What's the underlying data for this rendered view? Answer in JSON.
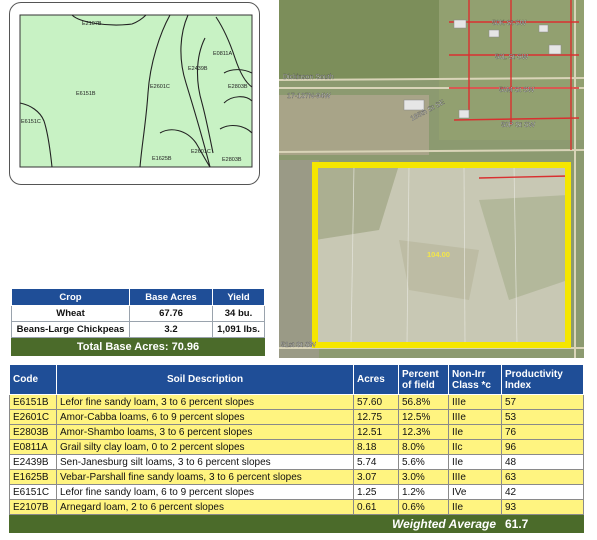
{
  "soil_map": {
    "labels": [
      "E2107B",
      "E6151B",
      "E2601C",
      "E0811A",
      "E2439B",
      "E2803B",
      "E6151C",
      "E1625B",
      "E2601C",
      "E2803B"
    ]
  },
  "aerial": {
    "road_labels": [
      "50K St SW",
      "50L St SW",
      "50M St SW",
      "50P St SW",
      "185th St SE",
      "Dickinson South",
      "17-137N-94W",
      "51st St SW"
    ],
    "field_value": "104.00",
    "boundary_color": "#f5e600"
  },
  "crop_table": {
    "headers": [
      "Crop",
      "Base Acres",
      "Yield"
    ],
    "rows": [
      {
        "crop": "Wheat",
        "base_acres": "67.76",
        "yield": "34 bu."
      },
      {
        "crop": "Beans-Large Chickpeas",
        "base_acres": "3.2",
        "yield": "1,091 lbs."
      }
    ],
    "total": "Total Base Acres: 70.96"
  },
  "soil_table": {
    "headers": {
      "code": "Code",
      "desc": "Soil Description",
      "acres": "Acres",
      "percent": "Percent of field",
      "class": "Non-Irr Class *c",
      "index": "Productivity Index"
    },
    "rows": [
      {
        "code": "E6151B",
        "desc": "Lefor fine sandy loam, 3 to 6 percent slopes",
        "acres": "57.60",
        "percent": "56.8%",
        "class": "IIIe",
        "index": "57",
        "highlight": true
      },
      {
        "code": "E2601C",
        "desc": "Amor-Cabba loams, 6 to 9 percent slopes",
        "acres": "12.75",
        "percent": "12.5%",
        "class": "IIIe",
        "index": "53",
        "highlight": true
      },
      {
        "code": "E2803B",
        "desc": "Amor-Shambo loams, 3 to 6 percent slopes",
        "acres": "12.51",
        "percent": "12.3%",
        "class": "IIe",
        "index": "76",
        "highlight": true
      },
      {
        "code": "E0811A",
        "desc": "Grail silty clay loam, 0 to 2 percent slopes",
        "acres": "8.18",
        "percent": "8.0%",
        "class": "IIc",
        "index": "96",
        "highlight": true
      },
      {
        "code": "E2439B",
        "desc": "Sen-Janesburg silt loams, 3 to 6 percent slopes",
        "acres": "5.74",
        "percent": "5.6%",
        "class": "IIe",
        "index": "48",
        "highlight": false
      },
      {
        "code": "E1625B",
        "desc": "Vebar-Parshall fine sandy loams, 3 to 6 percent slopes",
        "acres": "3.07",
        "percent": "3.0%",
        "class": "IIIe",
        "index": "63",
        "highlight": true
      },
      {
        "code": "E6151C",
        "desc": "Lefor fine sandy loam, 6 to 9 percent slopes",
        "acres": "1.25",
        "percent": "1.2%",
        "class": "IVe",
        "index": "42",
        "highlight": false
      },
      {
        "code": "E2107B",
        "desc": "Arnegard loam, 2 to 6 percent slopes",
        "acres": "0.61",
        "percent": "0.6%",
        "class": "IIe",
        "index": "93",
        "highlight": true
      }
    ],
    "weighted_label": "Weighted Average",
    "weighted_value": "61.7"
  },
  "colors": {
    "header_blue": "#1f4e97",
    "total_green": "#4b6b2a",
    "row_highlight": "#fff480",
    "soil_fill": "#c8f2c4"
  }
}
